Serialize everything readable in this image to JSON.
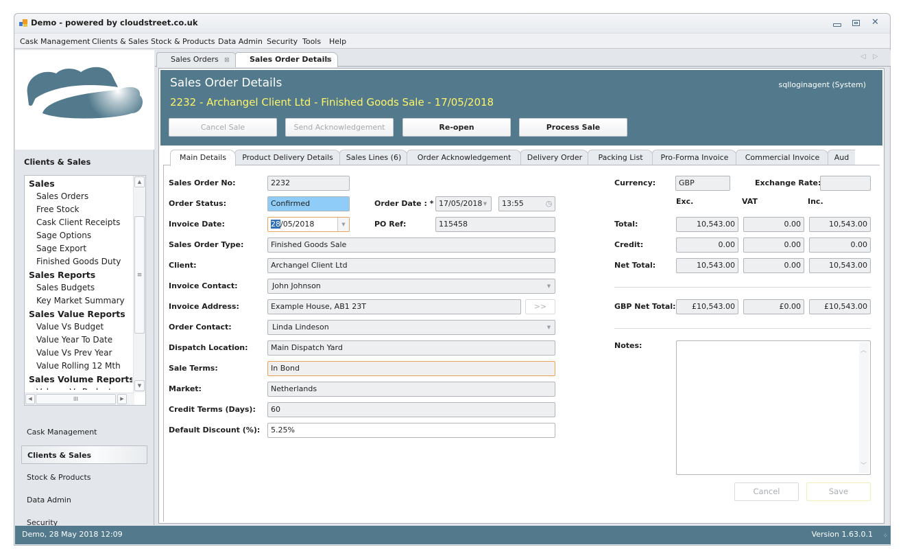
{
  "window": {
    "title": "Demo - powered by cloudstreet.co.uk",
    "controls": [
      "minimize",
      "restore",
      "close"
    ]
  },
  "menu": [
    "Cask Management",
    "Clients & Sales",
    "Stock & Products",
    "Data Admin",
    "Security",
    "Tools",
    "Help"
  ],
  "sidebar": {
    "section_title": "Clients & Sales",
    "tree": [
      {
        "label": "Sales",
        "type": "group"
      },
      {
        "label": "Sales Orders",
        "type": "item"
      },
      {
        "label": "Free Stock",
        "type": "item"
      },
      {
        "label": "Cask Client Receipts",
        "type": "item"
      },
      {
        "label": "Sage Options",
        "type": "item"
      },
      {
        "label": "Sage Export",
        "type": "item"
      },
      {
        "label": "Finished Goods Duty",
        "type": "item"
      },
      {
        "label": "Sales Reports",
        "type": "group"
      },
      {
        "label": "Sales Budgets",
        "type": "item"
      },
      {
        "label": "Key Market Summary",
        "type": "item"
      },
      {
        "label": "Sales Value Reports",
        "type": "group"
      },
      {
        "label": "Value Vs Budget",
        "type": "item"
      },
      {
        "label": "Value Year To Date",
        "type": "item"
      },
      {
        "label": "Value Vs Prev Year",
        "type": "item"
      },
      {
        "label": "Value Rolling 12 Mth",
        "type": "item"
      },
      {
        "label": "Sales Volume Reports",
        "type": "group"
      },
      {
        "label": "Volume Vs Budget",
        "type": "item"
      }
    ],
    "nav": [
      {
        "label": "Cask Management",
        "active": false
      },
      {
        "label": "Clients & Sales",
        "active": true
      },
      {
        "label": "Stock & Products",
        "active": false
      },
      {
        "label": "Data Admin",
        "active": false
      },
      {
        "label": "Security",
        "active": false
      }
    ]
  },
  "doc_tabs": [
    {
      "label": "Sales Orders",
      "active": false
    },
    {
      "label": "Sales Order Details",
      "active": true
    }
  ],
  "header": {
    "title": "Sales Order Details",
    "subtitle": "2232 - Archangel Client Ltd - Finished Goods Sale - 17/05/2018",
    "user": "sqlloginagent (System)",
    "buttons": {
      "cancel_sale": "Cancel Sale",
      "send_ack": "Send Acknowledgement",
      "reopen": "Re-open",
      "process_sale": "Process Sale"
    },
    "bg_color": "#527a8c",
    "subtitle_color": "#fff568"
  },
  "inner_tabs": [
    "Main Details",
    "Product Delivery Details",
    "Sales Lines (6)",
    "Order Acknowledgement",
    "Delivery Order",
    "Packing List",
    "Pro-Forma Invoice",
    "Commercial Invoice",
    "Aud"
  ],
  "form": {
    "sales_order_no": {
      "label": "Sales Order No:",
      "value": "2232"
    },
    "order_status": {
      "label": "Order Status:",
      "value": "Confirmed"
    },
    "order_date": {
      "label": "Order Date : *",
      "value": "17/05/2018",
      "time": "13:55"
    },
    "invoice_date": {
      "label": "Invoice Date:",
      "value_selected": "28",
      "value_rest": "/05/2018"
    },
    "po_ref": {
      "label": "PO Ref:",
      "value": "115458"
    },
    "sales_order_type": {
      "label": "Sales Order Type:",
      "value": "Finished Goods Sale"
    },
    "client": {
      "label": "Client:",
      "value": "Archangel Client Ltd"
    },
    "invoice_contact": {
      "label": "Invoice Contact:",
      "value": "John Johnson"
    },
    "invoice_address": {
      "label": "Invoice Address:",
      "value": "Example House, AB1 23T",
      "button": ">>"
    },
    "order_contact": {
      "label": "Order Contact:",
      "value": "Linda Lindeson"
    },
    "dispatch_location": {
      "label": "Dispatch Location:",
      "value": "Main Dispatch Yard"
    },
    "sale_terms": {
      "label": "Sale Terms:",
      "value": "In Bond"
    },
    "market": {
      "label": "Market:",
      "value": "Netherlands"
    },
    "credit_terms": {
      "label": "Credit Terms (Days):",
      "value": "60"
    },
    "default_discount": {
      "label": "Default Discount (%):",
      "value": "5.25%"
    }
  },
  "totals": {
    "currency_label": "Currency:",
    "currency": "GBP",
    "exchange_rate_label": "Exchange Rate:",
    "exchange_rate": "",
    "col_headers": [
      "Exc.",
      "VAT",
      "Inc."
    ],
    "rows": [
      {
        "label": "Total:",
        "values": [
          "10,543.00",
          "0.00",
          "10,543.00"
        ]
      },
      {
        "label": "Credit:",
        "values": [
          "0.00",
          "0.00",
          "0.00"
        ]
      },
      {
        "label": "Net Total:",
        "values": [
          "10,543.00",
          "0.00",
          "10,543.00"
        ]
      }
    ],
    "gbp_net_total": {
      "label": "GBP Net Total:",
      "values": [
        "£10,543.00",
        "£0.00",
        "£10,543.00"
      ]
    },
    "notes_label": "Notes:",
    "notes": ""
  },
  "footer_buttons": {
    "cancel": "Cancel",
    "save": "Save"
  },
  "status": {
    "left": "Demo, 28 May 2018 12:09",
    "right": "Version 1.63.0.1"
  }
}
